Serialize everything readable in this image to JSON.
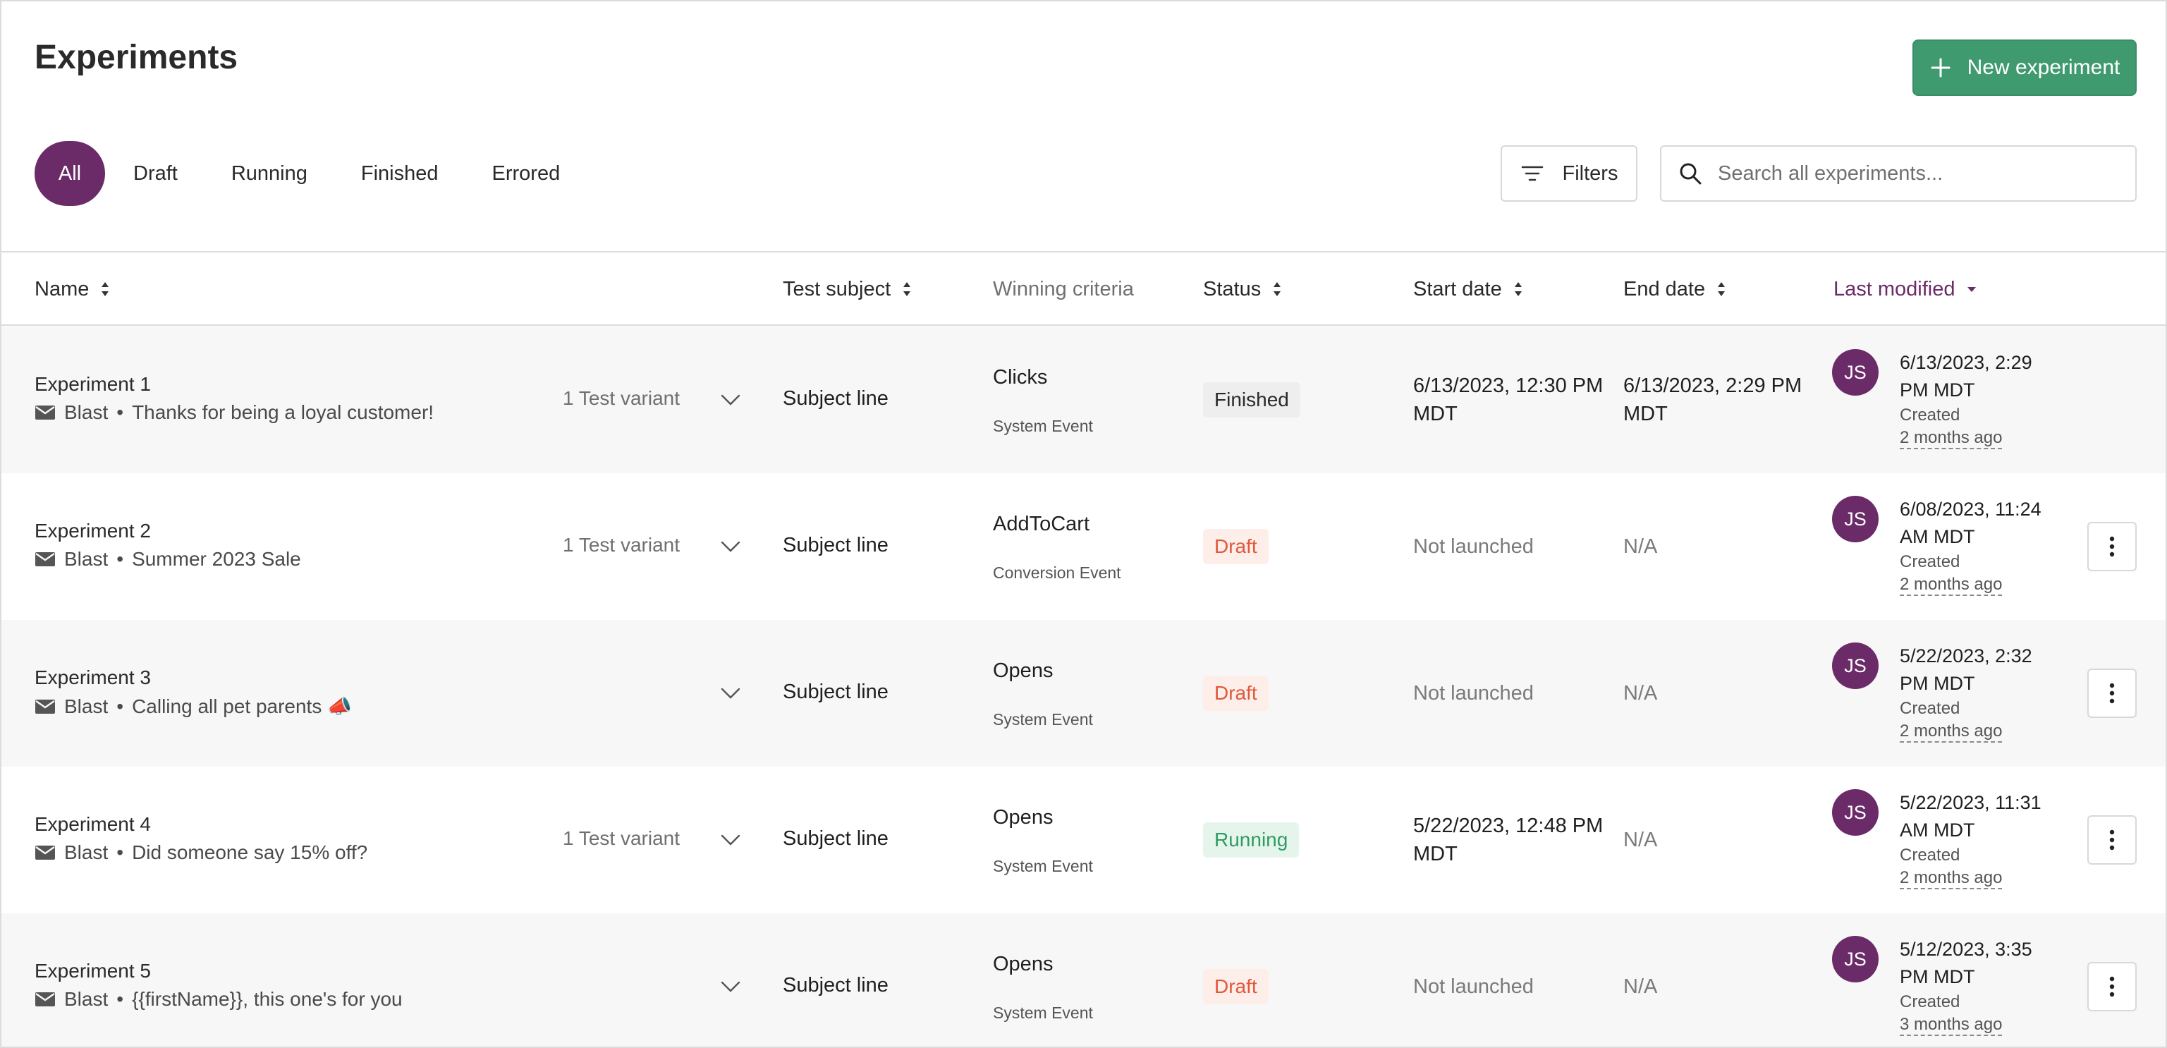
{
  "page": {
    "title": "Experiments"
  },
  "actions": {
    "new_experiment": "New experiment",
    "filters": "Filters"
  },
  "search": {
    "placeholder": "Search all experiments..."
  },
  "tabs": [
    "All",
    "Draft",
    "Running",
    "Finished",
    "Errored"
  ],
  "active_tab": "All",
  "columns": {
    "name": "Name",
    "test_subject": "Test subject",
    "winning_criteria": "Winning criteria",
    "status": "Status",
    "start_date": "Start date",
    "end_date": "End date",
    "last_modified": "Last modified"
  },
  "colors": {
    "accent": "#6b2a68",
    "primary_button": "#3f9a70",
    "draft": "#e0583a",
    "running": "#2e9c62"
  },
  "rows": [
    {
      "name": "Experiment 1",
      "channel": "Blast",
      "message": "Thanks for being a loyal customer!",
      "variants": "1 Test variant",
      "test_subject": "Subject line",
      "criteria": "Clicks",
      "criteria_type": "System Event",
      "status": "Finished",
      "start_date": [
        "6/13/2023, 12:30 PM",
        "MDT"
      ],
      "end_date": [
        "6/13/2023, 2:29 PM",
        "MDT"
      ],
      "avatar": "JS",
      "modified": [
        "6/13/2023, 2:29",
        "PM MDT"
      ],
      "modified_action": "Created",
      "modified_ago": "2 months ago"
    },
    {
      "name": "Experiment 2",
      "channel": "Blast",
      "message": "Summer 2023 Sale",
      "variants": "1 Test variant",
      "test_subject": "Subject line",
      "criteria": "AddToCart",
      "criteria_type": "Conversion Event",
      "status": "Draft",
      "start_date": [
        "Not launched"
      ],
      "end_date": [
        "N/A"
      ],
      "avatar": "JS",
      "modified": [
        "6/08/2023, 11:24",
        "AM MDT"
      ],
      "modified_action": "Created",
      "modified_ago": "2 months ago"
    },
    {
      "name": "Experiment 3",
      "channel": "Blast",
      "message": "Calling all pet parents 📣",
      "variants": "",
      "test_subject": "Subject line",
      "criteria": "Opens",
      "criteria_type": "System Event",
      "status": "Draft",
      "start_date": [
        "Not launched"
      ],
      "end_date": [
        "N/A"
      ],
      "avatar": "JS",
      "modified": [
        "5/22/2023, 2:32",
        "PM MDT"
      ],
      "modified_action": "Created",
      "modified_ago": "2 months ago"
    },
    {
      "name": "Experiment 4",
      "channel": "Blast",
      "message": "Did someone say 15% off?",
      "variants": "1 Test variant",
      "test_subject": "Subject line",
      "criteria": "Opens",
      "criteria_type": "System Event",
      "status": "Running",
      "start_date": [
        "5/22/2023, 12:48 PM",
        "MDT"
      ],
      "end_date": [
        "N/A"
      ],
      "avatar": "JS",
      "modified": [
        "5/22/2023, 11:31",
        "AM MDT"
      ],
      "modified_action": "Created",
      "modified_ago": "2 months ago"
    },
    {
      "name": "Experiment 5",
      "channel": "Blast",
      "message": "{{firstName}}, this one's for you",
      "variants": "",
      "test_subject": "Subject line",
      "criteria": "Opens",
      "criteria_type": "System Event",
      "status": "Draft",
      "start_date": [
        "Not launched"
      ],
      "end_date": [
        "N/A"
      ],
      "avatar": "JS",
      "modified": [
        "5/12/2023, 3:35",
        "PM MDT"
      ],
      "modified_action": "Created",
      "modified_ago": "3 months ago"
    }
  ]
}
